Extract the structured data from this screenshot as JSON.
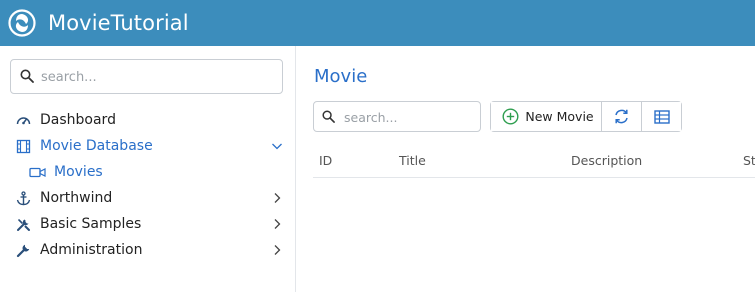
{
  "app": {
    "title": "MovieTutorial"
  },
  "colors": {
    "header": "#3c8dbc",
    "accent": "#2a6fc9",
    "plus": "#2e9e4f"
  },
  "sidebar": {
    "search_placeholder": "search...",
    "items": [
      {
        "label": "Dashboard",
        "icon": "dashboard-icon",
        "active": false,
        "expandable": false
      },
      {
        "label": "Movie Database",
        "icon": "film-icon",
        "active": true,
        "expandable": true,
        "expanded": true
      },
      {
        "label": "Movies",
        "icon": "video-camera-icon",
        "sub": true
      },
      {
        "label": "Northwind",
        "icon": "anchor-icon",
        "expandable": true
      },
      {
        "label": "Basic Samples",
        "icon": "tools-icon",
        "expandable": true
      },
      {
        "label": "Administration",
        "icon": "wrench-icon",
        "expandable": true
      }
    ]
  },
  "main": {
    "page_title": "Movie",
    "grid": {
      "search_placeholder": "search...",
      "toolbar": {
        "new_label": "New Movie",
        "refresh_icon": "refresh-icon",
        "columns_icon": "columns-icon"
      },
      "columns": [
        "ID",
        "Title",
        "Description",
        "St"
      ]
    }
  }
}
